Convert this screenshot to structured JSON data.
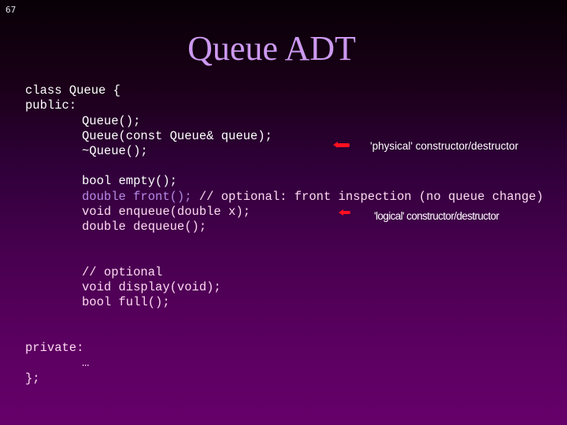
{
  "slide": {
    "number": "67",
    "title": "Queue ADT"
  },
  "code": {
    "line_class": "class Queue {",
    "line_public": "public:",
    "line_ctor": "Queue();",
    "line_copy_ctor": "Queue(const Queue& queue);",
    "line_dtor": "~Queue();",
    "line_empty": "bool empty();",
    "line_front_decl": "double front();",
    "line_front_comment": " // optional: front inspection (no queue change)",
    "line_enqueue": "void enqueue(double x);",
    "line_dequeue": "double dequeue();",
    "line_optional_comment": "// optional",
    "line_display": "void display(void);",
    "line_full": "bool full();",
    "line_private": "private:",
    "line_ellipsis": "…",
    "line_close": "};"
  },
  "annotations": {
    "physical": "'physical' constructor/destructor",
    "logical": "'logical' constructor/destructor"
  },
  "colors": {
    "arrow": "#ff1020",
    "title": "#cc99f0",
    "highlight": "#b68ae6",
    "background_top": "#080006",
    "background_bottom": "#66006a"
  }
}
